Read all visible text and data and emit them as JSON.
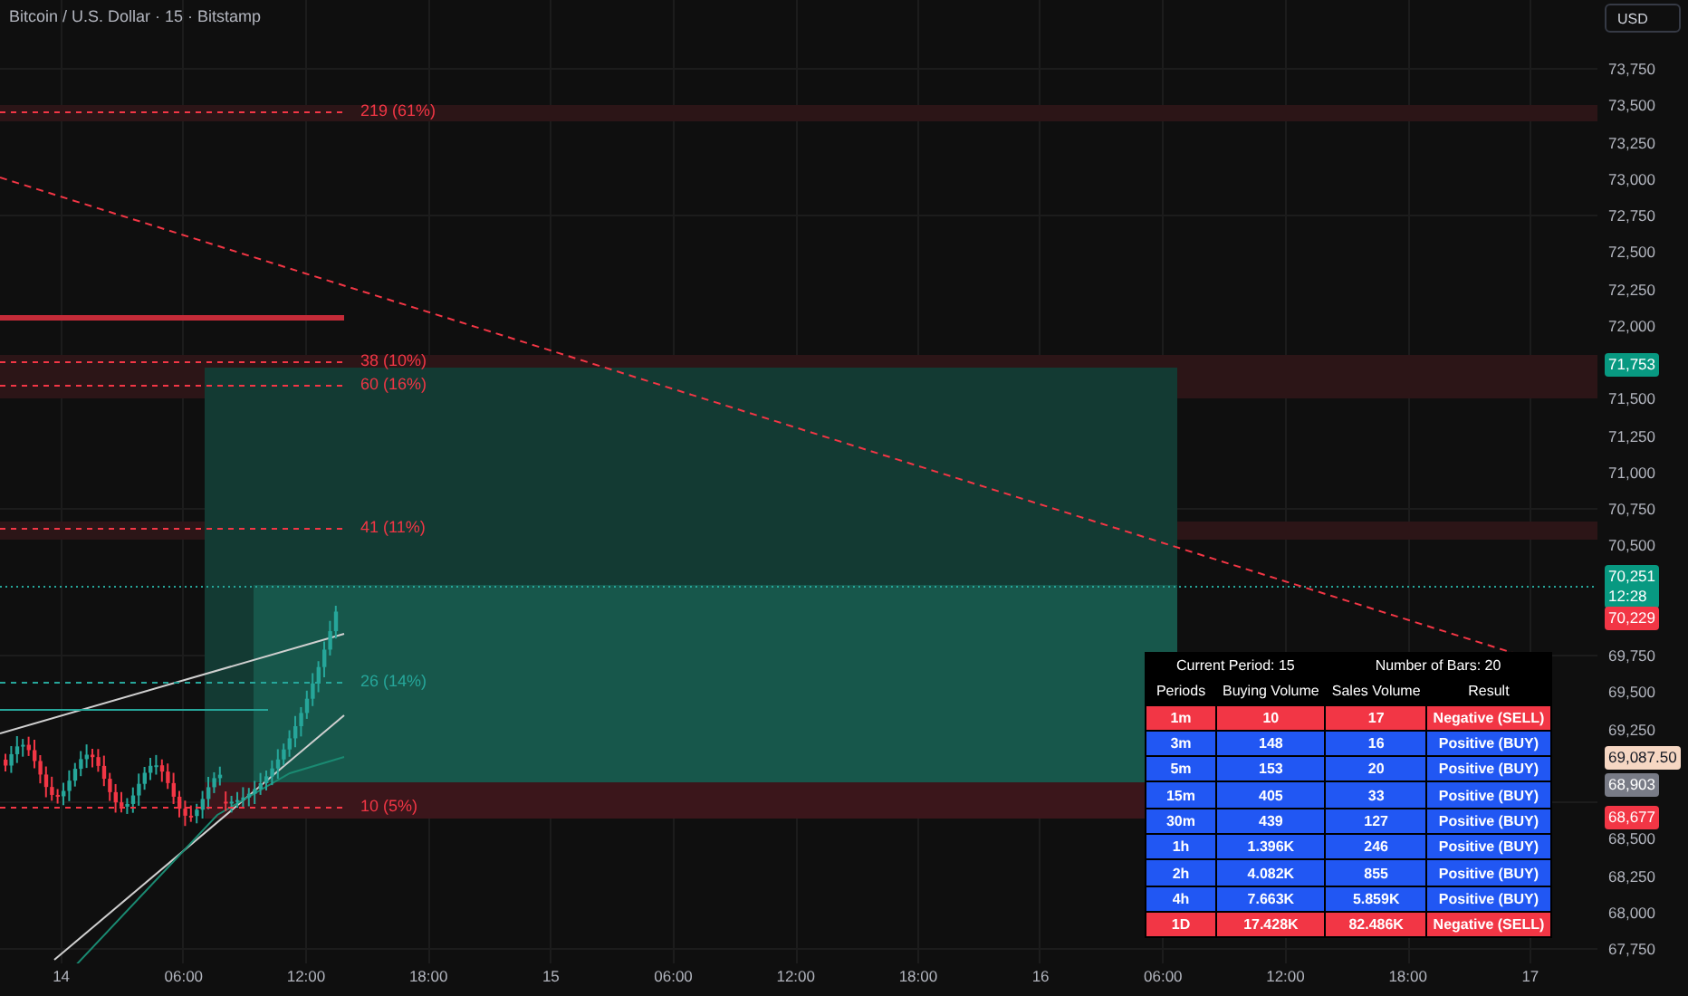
{
  "header": {
    "title": "Bitcoin / U.S. Dollar · 15 · Bitstamp",
    "currency": "USD"
  },
  "fib_levels": [
    {
      "label": "219 (61%)",
      "color": "#f23645"
    },
    {
      "label": "38 (10%)",
      "color": "#f23645"
    },
    {
      "label": "60 (16%)",
      "color": "#f23645"
    },
    {
      "label": "41 (11%)",
      "color": "#f23645"
    },
    {
      "label": "26 (14%)",
      "color": "#26a69a"
    },
    {
      "label": "10 (5%)",
      "color": "#f23645"
    }
  ],
  "price_axis": {
    "labels": [
      "73,750",
      "73,500",
      "73,250",
      "73,000",
      "72,750",
      "72,500",
      "72,250",
      "72,000",
      "71,500",
      "71,250",
      "71,000",
      "70,750",
      "70,500",
      "69,750",
      "69,500",
      "69,250",
      "68,500",
      "68,250",
      "68,000",
      "67,750"
    ]
  },
  "price_tags": [
    {
      "text": "71,753",
      "color": "#089981"
    },
    {
      "text": "70,251",
      "sub": "12:28",
      "color": "#089981"
    },
    {
      "text": "70,229",
      "color": "#f23645"
    },
    {
      "text": "69,087.50",
      "color": "#f6d7c3"
    },
    {
      "text": "68,903",
      "color": "#787b86"
    },
    {
      "text": "68,677",
      "color": "#f23645"
    }
  ],
  "time_axis": {
    "labels": [
      "14",
      "06:00",
      "12:00",
      "18:00",
      "15",
      "06:00",
      "12:00",
      "18:00",
      "16",
      "06:00",
      "12:00",
      "18:00",
      "17"
    ]
  },
  "table": {
    "header": [
      "Current Period: 15",
      "Number of Bars: 20"
    ],
    "columns": [
      "Periods",
      "Buying Volume",
      "Sales Volume",
      "Result"
    ],
    "rows": [
      {
        "cells": [
          "1m",
          "10",
          "17",
          "Negative (SELL)"
        ],
        "color": "#f23645"
      },
      {
        "cells": [
          "3m",
          "148",
          "16",
          "Positive (BUY)"
        ],
        "color": "#2157f3"
      },
      {
        "cells": [
          "5m",
          "153",
          "20",
          "Positive (BUY)"
        ],
        "color": "#2157f3"
      },
      {
        "cells": [
          "15m",
          "405",
          "33",
          "Positive (BUY)"
        ],
        "color": "#2157f3"
      },
      {
        "cells": [
          "30m",
          "439",
          "127",
          "Positive (BUY)"
        ],
        "color": "#2157f3"
      },
      {
        "cells": [
          "1h",
          "1.396K",
          "246",
          "Positive (BUY)"
        ],
        "color": "#2157f3"
      },
      {
        "cells": [
          "2h",
          "4.082K",
          "855",
          "Positive (BUY)"
        ],
        "color": "#2157f3"
      },
      {
        "cells": [
          "4h",
          "7.663K",
          "5.859K",
          "Positive (BUY)"
        ],
        "color": "#2157f3"
      },
      {
        "cells": [
          "1D",
          "17.428K",
          "82.486K",
          "Negative (SELL)"
        ],
        "color": "#f23645"
      }
    ]
  }
}
